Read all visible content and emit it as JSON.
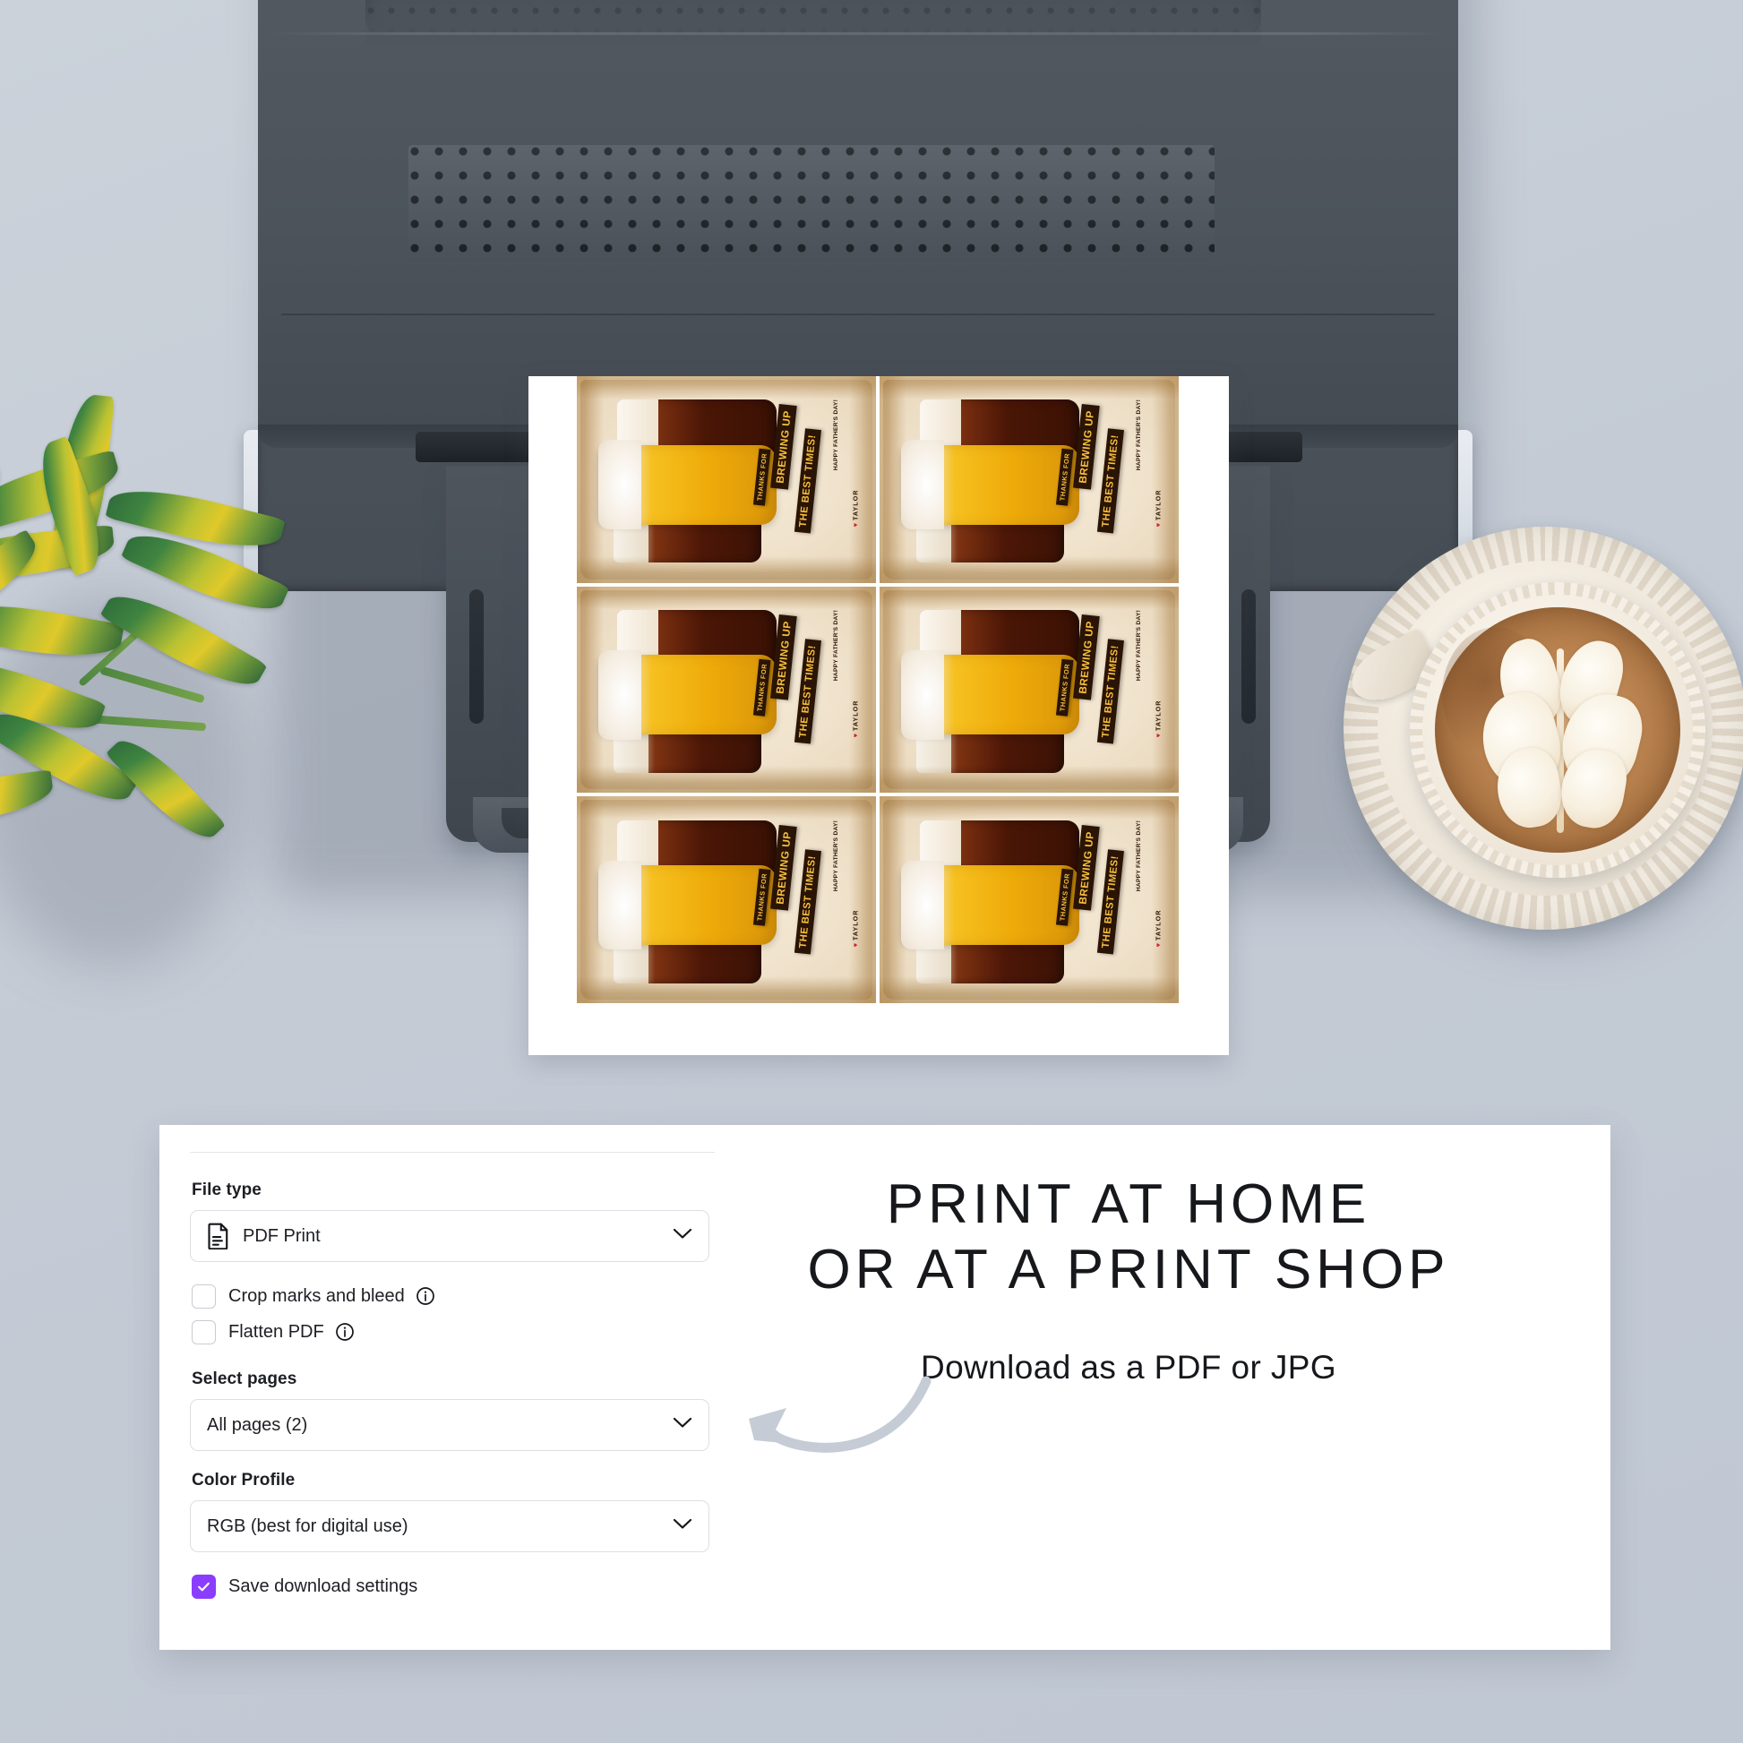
{
  "background": {
    "color": "#c4cbd5"
  },
  "printer": {
    "name": "desktop-inkjet-printer",
    "body_color": "#4e555d",
    "controls": [
      {
        "icon": "close-icon",
        "name": "cancel-button"
      },
      {
        "icon": "power-icon",
        "name": "power-button"
      }
    ]
  },
  "printed_sheet": {
    "name": "printed-tag-sheet",
    "columns": 2,
    "rows": 3,
    "card": {
      "line1": "THANKS FOR",
      "line2": "BREWING UP",
      "line3": "THE BEST TIMES!",
      "greeting": "HAPPY FATHER'S DAY!",
      "heart": "♥",
      "signature": "TAYLOR",
      "ribbon_bg": "#2a1405",
      "ribbon_text_color": "#f6bf3f"
    }
  },
  "decor": {
    "plant": "potted-plant",
    "coffee": "latte-cup-with-saucer"
  },
  "panel": {
    "name": "download-settings-panel",
    "file_type": {
      "label": "File type",
      "value": "PDF Print",
      "icon": "document-icon",
      "chevron": "chevron-down-icon"
    },
    "checkboxes": [
      {
        "label": "Crop marks and bleed",
        "checked": false,
        "info": "info-icon"
      },
      {
        "label": "Flatten PDF",
        "checked": false,
        "info": "info-icon"
      }
    ],
    "select_pages": {
      "label": "Select pages",
      "value": "All pages (2)",
      "chevron": "chevron-down-icon"
    },
    "color_profile": {
      "label": "Color Profile",
      "value": "RGB (best for digital use)",
      "chevron": "chevron-down-icon"
    },
    "save_settings": {
      "label": "Save download settings",
      "checked": true,
      "accent": "#8b3dff"
    }
  },
  "copy": {
    "headline_line1": "PRINT AT HOME",
    "headline_line2": "OR AT A PRINT SHOP",
    "subline": "Download as a PDF or JPG",
    "arrow": "curved-arrow-left-icon",
    "arrow_color": "#c5ccd6"
  }
}
